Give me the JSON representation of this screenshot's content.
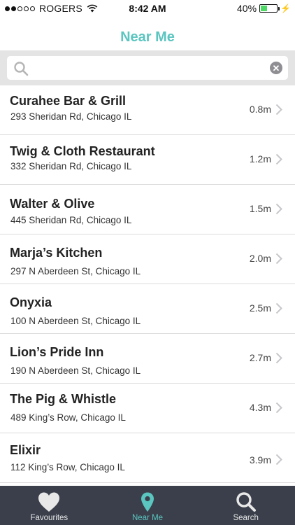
{
  "status_bar": {
    "carrier": "ROGERS",
    "signal_bars": 2,
    "time": "8:42 AM",
    "battery_percent": "40%",
    "battery_level": 0.4
  },
  "nav": {
    "title": "Near Me"
  },
  "search": {
    "value": "",
    "placeholder": ""
  },
  "places": [
    {
      "name": "Curahee Bar & Grill",
      "address": "293 Sheridan Rd, Chicago IL",
      "distance": "0.8m"
    },
    {
      "name": "Twig & Cloth Restaurant",
      "address": "332 Sheridan Rd, Chicago IL",
      "distance": "1.2m"
    },
    {
      "name": "Walter & Olive",
      "address": "445 Sheridan Rd, Chicago IL",
      "distance": "1.5m"
    },
    {
      "name": "Marja’s Kitchen",
      "address": "297 N Aberdeen St, Chicago IL",
      "distance": "2.0m"
    },
    {
      "name": "Onyxia",
      "address": "100 N Aberdeen St, Chicago IL",
      "distance": "2.5m"
    },
    {
      "name": "Lion’s Pride Inn",
      "address": "190 N Aberdeen St, Chicago IL",
      "distance": "2.7m"
    },
    {
      "name": "The Pig & Whistle",
      "address": "489 King’s Row, Chicago IL",
      "distance": "4.3m"
    },
    {
      "name": "Elixir",
      "address": "112 King’s Row, Chicago IL",
      "distance": "3.9m"
    }
  ],
  "tabs": [
    {
      "label": "Favourites",
      "icon": "heart-icon",
      "active": false
    },
    {
      "label": "Near Me",
      "icon": "location-pin-icon",
      "active": true
    },
    {
      "label": "Search",
      "icon": "search-icon",
      "active": false
    }
  ],
  "colors": {
    "accent": "#5bc5c0",
    "tab_bar": "#3a3f4b",
    "battery": "#4cd964"
  }
}
